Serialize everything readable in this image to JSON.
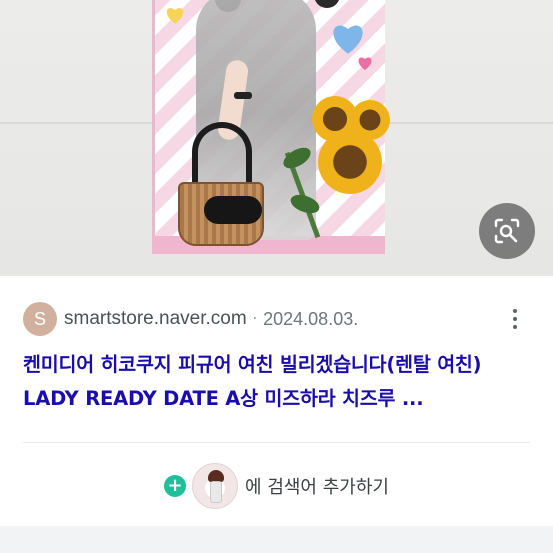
{
  "result": {
    "source": {
      "favicon_letter": "S",
      "domain": "smartstore.naver.com",
      "separator": "·",
      "date": "2024.08.03."
    },
    "title": "켄미디어 히코쿠지 피규어 여친 빌리겠습니다(렌탈 여친) LADY READY DATE A상 미즈하라 치즈루 ...",
    "more_icon": "more-vert-icon"
  },
  "lens_button": {
    "icon": "image-search-icon"
  },
  "add_search": {
    "plus_icon": "plus-icon",
    "label": "에 검색어 추가하기"
  },
  "colors": {
    "title_link": "#1a0dab",
    "accent_green": "#1fbf9a",
    "favicon_bg": "#d1b19e"
  }
}
